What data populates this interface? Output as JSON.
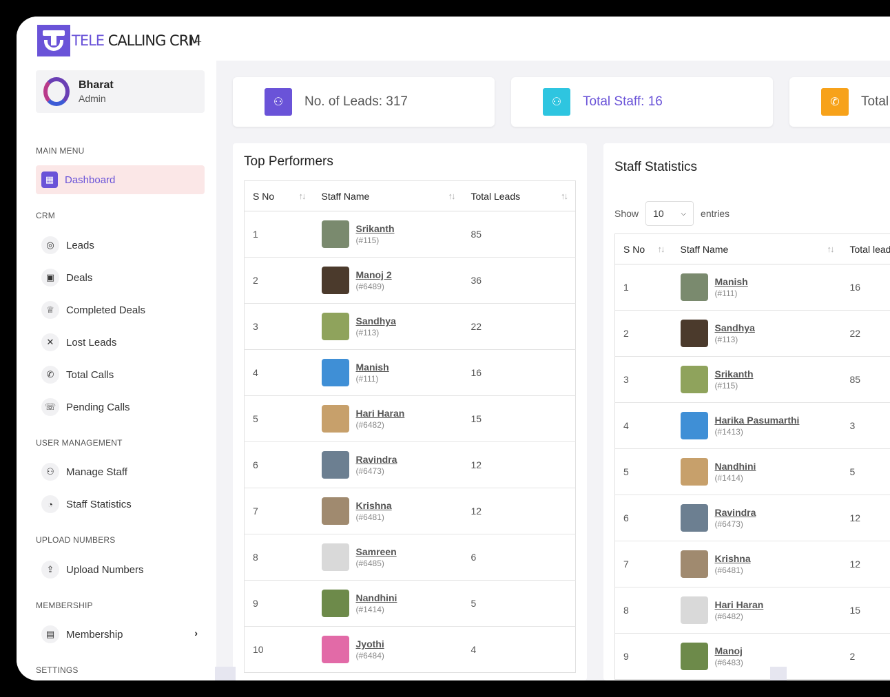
{
  "app": {
    "logo_text_a": "TELE",
    "logo_text_b": " CALLING CRM",
    "collapse_icon": "collapse-left-icon"
  },
  "profile": {
    "name": "Bharat",
    "role": "Admin"
  },
  "sidebar": {
    "sections": {
      "main": "MAIN MENU",
      "crm": "CRM",
      "user_mgmt": "USER MANAGEMENT",
      "upload": "UPLOAD NUMBERS",
      "membership": "MEMBERSHIP",
      "settings": "SETTINGS"
    },
    "items": [
      {
        "label": "Dashboard",
        "icon": "grid-icon",
        "glyph": "▦"
      },
      {
        "label": "Leads",
        "icon": "target-icon",
        "glyph": "◎"
      },
      {
        "label": "Deals",
        "icon": "briefcase-icon",
        "glyph": "▣"
      },
      {
        "label": "Completed Deals",
        "icon": "trophy-icon",
        "glyph": "♕"
      },
      {
        "label": "Lost Leads",
        "icon": "close-icon",
        "glyph": "✕"
      },
      {
        "label": "Total Calls",
        "icon": "phone-icon",
        "glyph": "✆"
      },
      {
        "label": "Pending Calls",
        "icon": "phone-ring-icon",
        "glyph": "☏"
      },
      {
        "label": "Manage Staff",
        "icon": "users-icon",
        "glyph": "⚇"
      },
      {
        "label": "Staff Statistics",
        "icon": "pie-chart-icon",
        "glyph": "◔"
      },
      {
        "label": "Upload Numbers",
        "icon": "upload-icon",
        "glyph": "⇪"
      },
      {
        "label": "Membership",
        "icon": "document-icon",
        "glyph": "▤"
      }
    ]
  },
  "stats": [
    {
      "label": "No. of Leads: 317",
      "color": "#6a53d8",
      "icon": "users-icon"
    },
    {
      "label": "Total Staff: 16",
      "color": "#2ec5e0",
      "icon": "users-icon"
    },
    {
      "label": "Total",
      "color": "#f7a21a",
      "icon": "phone-icon"
    }
  ],
  "top_performers": {
    "title": "Top Performers",
    "columns": [
      "S No",
      "Staff Name",
      "Total Leads"
    ],
    "rows": [
      {
        "sno": "1",
        "name": "Srikanth",
        "id": "(#115)",
        "total": "85"
      },
      {
        "sno": "2",
        "name": "Manoj 2",
        "id": "(#6489)",
        "total": "36"
      },
      {
        "sno": "3",
        "name": "Sandhya",
        "id": "(#113)",
        "total": "22"
      },
      {
        "sno": "4",
        "name": "Manish",
        "id": "(#111)",
        "total": "16"
      },
      {
        "sno": "5",
        "name": "Hari Haran",
        "id": "(#6482)",
        "total": "15"
      },
      {
        "sno": "6",
        "name": "Ravindra",
        "id": "(#6473)",
        "total": "12"
      },
      {
        "sno": "7",
        "name": "Krishna",
        "id": "(#6481)",
        "total": "12"
      },
      {
        "sno": "8",
        "name": "Samreen",
        "id": "(#6485)",
        "total": "6"
      },
      {
        "sno": "9",
        "name": "Nandhini",
        "id": "(#1414)",
        "total": "5"
      },
      {
        "sno": "10",
        "name": "Jyothi",
        "id": "(#6484)",
        "total": "4"
      }
    ]
  },
  "staff_statistics": {
    "title": "Staff Statistics",
    "show_label": "Show",
    "entries_value": "10",
    "entries_label": "entries",
    "columns": [
      "S No",
      "Staff Name",
      "Total lead"
    ],
    "rows": [
      {
        "sno": "1",
        "name": "Manish",
        "id": "(#111)",
        "total": "16"
      },
      {
        "sno": "2",
        "name": "Sandhya",
        "id": "(#113)",
        "total": "22"
      },
      {
        "sno": "3",
        "name": "Srikanth",
        "id": "(#115)",
        "total": "85"
      },
      {
        "sno": "4",
        "name": "Harika Pasumarthi",
        "id": "(#1413)",
        "total": "3"
      },
      {
        "sno": "5",
        "name": "Nandhini",
        "id": "(#1414)",
        "total": "5"
      },
      {
        "sno": "6",
        "name": "Ravindra",
        "id": "(#6473)",
        "total": "12"
      },
      {
        "sno": "7",
        "name": "Krishna",
        "id": "(#6481)",
        "total": "12"
      },
      {
        "sno": "8",
        "name": "Hari Haran",
        "id": "(#6482)",
        "total": "15"
      },
      {
        "sno": "9",
        "name": "Manoj",
        "id": "(#6483)",
        "total": "2"
      }
    ]
  }
}
